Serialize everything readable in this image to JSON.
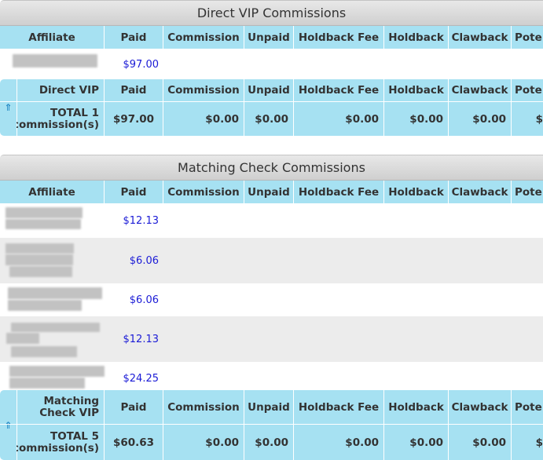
{
  "direct": {
    "title": "Direct VIP Commissions",
    "headers": [
      "Affiliate",
      "Paid",
      "Commission",
      "Unpaid",
      "Holdback Fee",
      "Holdback",
      "Clawback",
      "Pote"
    ],
    "rows": [
      {
        "paid": "$97.00"
      }
    ],
    "footer_headers": [
      "Direct VIP",
      "Paid",
      "Commission",
      "Unpaid",
      "Holdback Fee",
      "Holdback",
      "Clawback",
      "Pote"
    ],
    "total": {
      "label_line1": "TOTAL 1",
      "label_line2": "commission(s)",
      "paid": "$97.00",
      "commission": "$0.00",
      "unpaid": "$0.00",
      "holdback_fee": "$0.00",
      "holdback": "$0.00",
      "clawback": "$0.00",
      "pote": "$"
    },
    "up_icon": "⇑"
  },
  "matching": {
    "title": "Matching Check Commissions",
    "headers": [
      "Affiliate",
      "Paid",
      "Commission",
      "Unpaid",
      "Holdback Fee",
      "Holdback",
      "Clawback",
      "Pote"
    ],
    "rows": [
      {
        "paid": "$12.13"
      },
      {
        "paid": "$6.06"
      },
      {
        "paid": "$6.06"
      },
      {
        "paid": "$12.13"
      },
      {
        "paid": "$24.25"
      }
    ],
    "footer_headers": [
      "Matching Check VIP",
      "Paid",
      "Commission",
      "Unpaid",
      "Holdback Fee",
      "Holdback",
      "Clawback",
      "Pote"
    ],
    "footer_label_line1": "Matching",
    "footer_label_line2": "Check VIP",
    "total": {
      "label_line1": "TOTAL 5",
      "label_line2": "commission(s)",
      "paid": "$60.63",
      "commission": "$0.00",
      "unpaid": "$0.00",
      "holdback_fee": "$0.00",
      "holdback": "$0.00",
      "clawback": "$0.00",
      "pote": "$"
    },
    "up_icon": "⇑"
  },
  "colors": {
    "header_bg": "#a6e1f2",
    "amount_link": "#1b1bd6",
    "title_bg": "#d9d9d9"
  }
}
